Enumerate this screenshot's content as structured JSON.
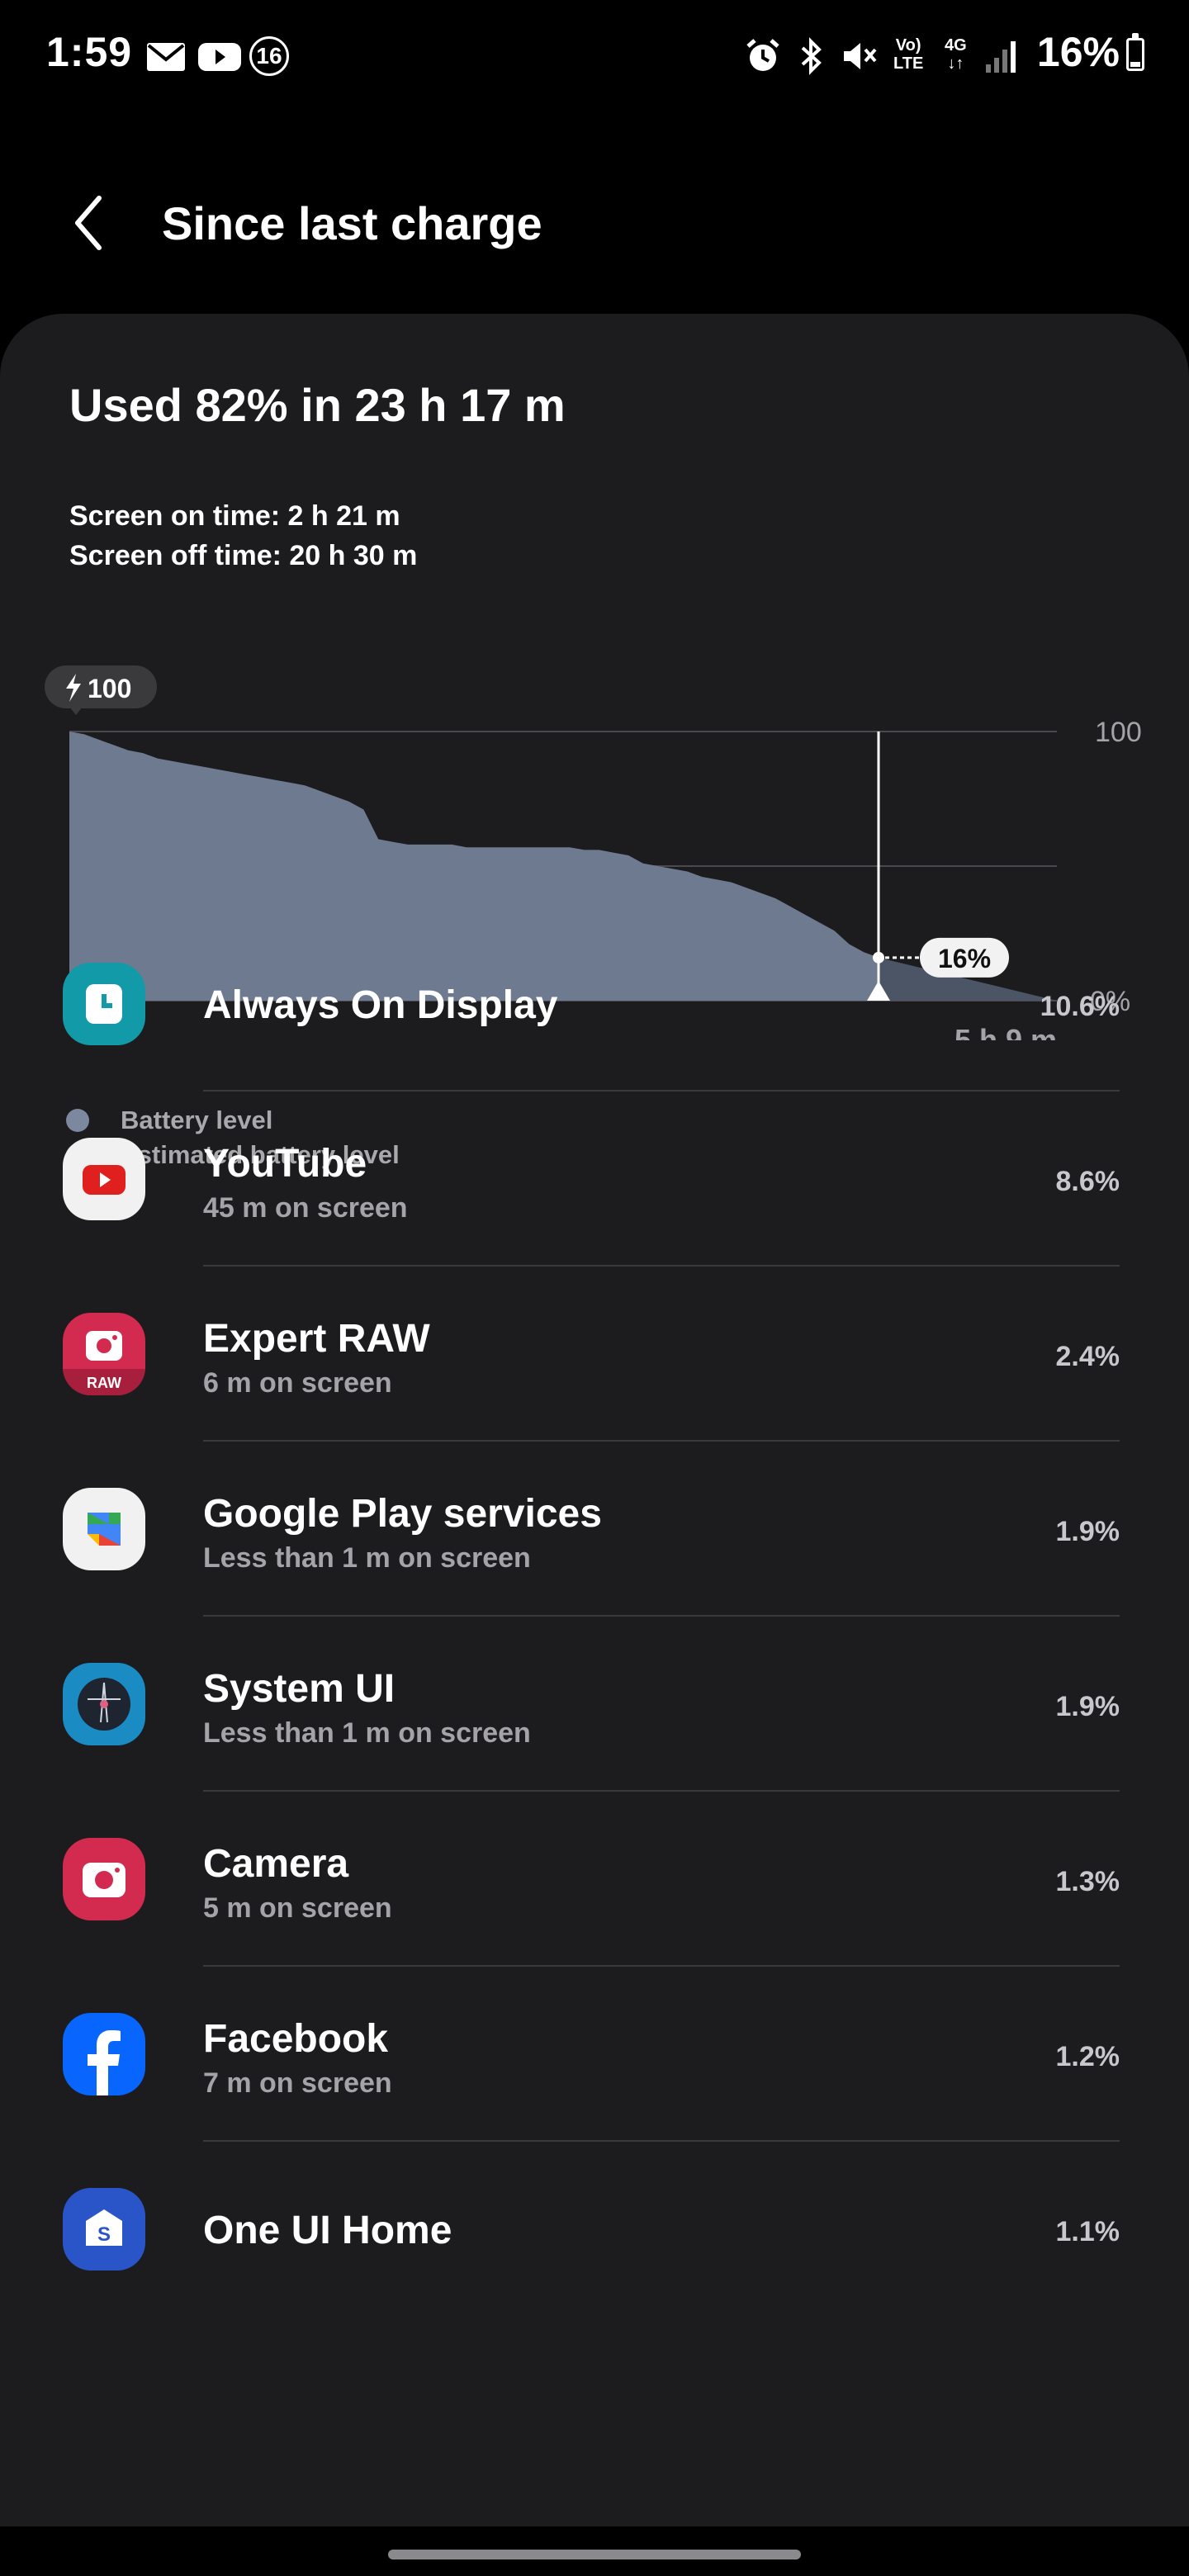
{
  "status_bar": {
    "time": "1:59",
    "notification_count": "16",
    "battery_percent": "16%",
    "icons": [
      "gmail-icon",
      "youtube-icon",
      "badge-icon",
      "alarm-icon",
      "bluetooth-icon",
      "mute-icon",
      "volte-icon",
      "4g-icon",
      "signal-icon",
      "battery-icon"
    ]
  },
  "header": {
    "title": "Since last charge"
  },
  "summary": {
    "title": "Used 82% in 23 h 17 m",
    "screen_on": "Screen on time: 2 h 21 m",
    "screen_off": "Screen off time: 20 h 30 m"
  },
  "chart_data": {
    "type": "area",
    "start_label": "100",
    "y_tick_labels": [
      "100",
      "0%"
    ],
    "ylim": [
      0,
      100
    ],
    "remaining_label": "5 h 9 m",
    "current_value_label": "16%",
    "current_value": 16,
    "series": [
      {
        "name": "Battery level",
        "color": "#6e7a90",
        "values": [
          100,
          99,
          97,
          95,
          93,
          92,
          90,
          89,
          88,
          87,
          86,
          85,
          84,
          83,
          82,
          81,
          80,
          78,
          76,
          74,
          71,
          60,
          59,
          58,
          58,
          58,
          58,
          57,
          57,
          57,
          57,
          57,
          57,
          57,
          57,
          56,
          56,
          55,
          54,
          51,
          50,
          49,
          48,
          46,
          45,
          44,
          42,
          40,
          38,
          35,
          32,
          29,
          26,
          21,
          18,
          16
        ]
      },
      {
        "name": "Estimated battery level",
        "color": "#4c5566",
        "values": [
          16,
          0
        ]
      }
    ]
  },
  "legend": [
    {
      "label": "Battery level",
      "color": "#7c87a0"
    },
    {
      "label": "Estimated battery level",
      "color": "#5a6171"
    }
  ],
  "apps": [
    {
      "name": "Always On Display",
      "sub": "",
      "percent": "10.6%",
      "icon": "always-on-display-icon"
    },
    {
      "name": "YouTube",
      "sub": "45 m on screen",
      "percent": "8.6%",
      "icon": "youtube-icon"
    },
    {
      "name": "Expert RAW",
      "sub": "6 m on screen",
      "percent": "2.4%",
      "icon": "expert-raw-icon",
      "icon_text": "RAW"
    },
    {
      "name": "Google Play services",
      "sub": "Less than 1 m on screen",
      "percent": "1.9%",
      "icon": "google-play-services-icon"
    },
    {
      "name": "System UI",
      "sub": "Less than 1 m on screen",
      "percent": "1.9%",
      "icon": "system-ui-icon"
    },
    {
      "name": "Camera",
      "sub": "5 m on screen",
      "percent": "1.3%",
      "icon": "camera-icon"
    },
    {
      "name": "Facebook",
      "sub": "7 m on screen",
      "percent": "1.2%",
      "icon": "facebook-icon"
    },
    {
      "name": "One UI Home",
      "sub": "",
      "percent": "1.1%",
      "icon": "one-ui-home-icon"
    }
  ]
}
